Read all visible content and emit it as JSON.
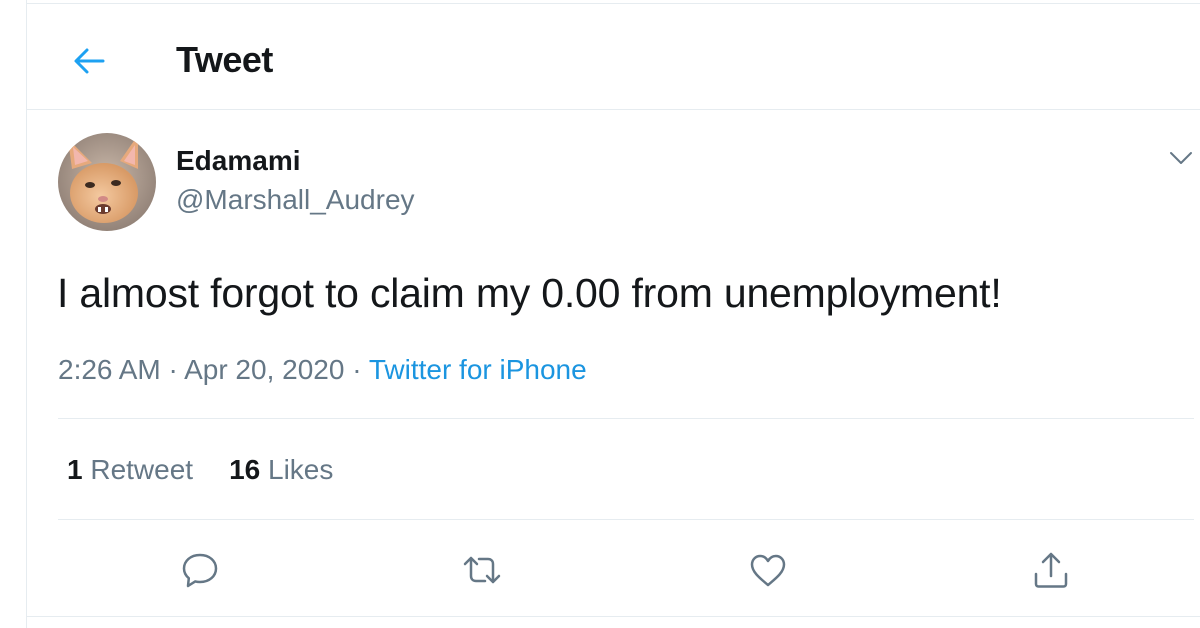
{
  "header": {
    "title": "Tweet"
  },
  "tweet": {
    "author_name": "Edamami",
    "author_handle": "@Marshall_Audrey",
    "text": "I almost forgot to claim my 0.00 from unemployment!",
    "time": "2:26 AM",
    "date": "Apr 20, 2020",
    "separator": "·",
    "source": "Twitter for iPhone"
  },
  "stats": {
    "retweets_count": "1",
    "retweets_label": "Retweet",
    "likes_count": "16",
    "likes_label": "Likes"
  },
  "actions": [
    "reply-icon",
    "retweet-icon",
    "like-icon",
    "share-icon"
  ],
  "colors": {
    "accent": "#1da1f2",
    "link": "#1b95e0",
    "secondary_text": "#657786",
    "divider": "#e6ecf0",
    "icon": "#657786"
  }
}
